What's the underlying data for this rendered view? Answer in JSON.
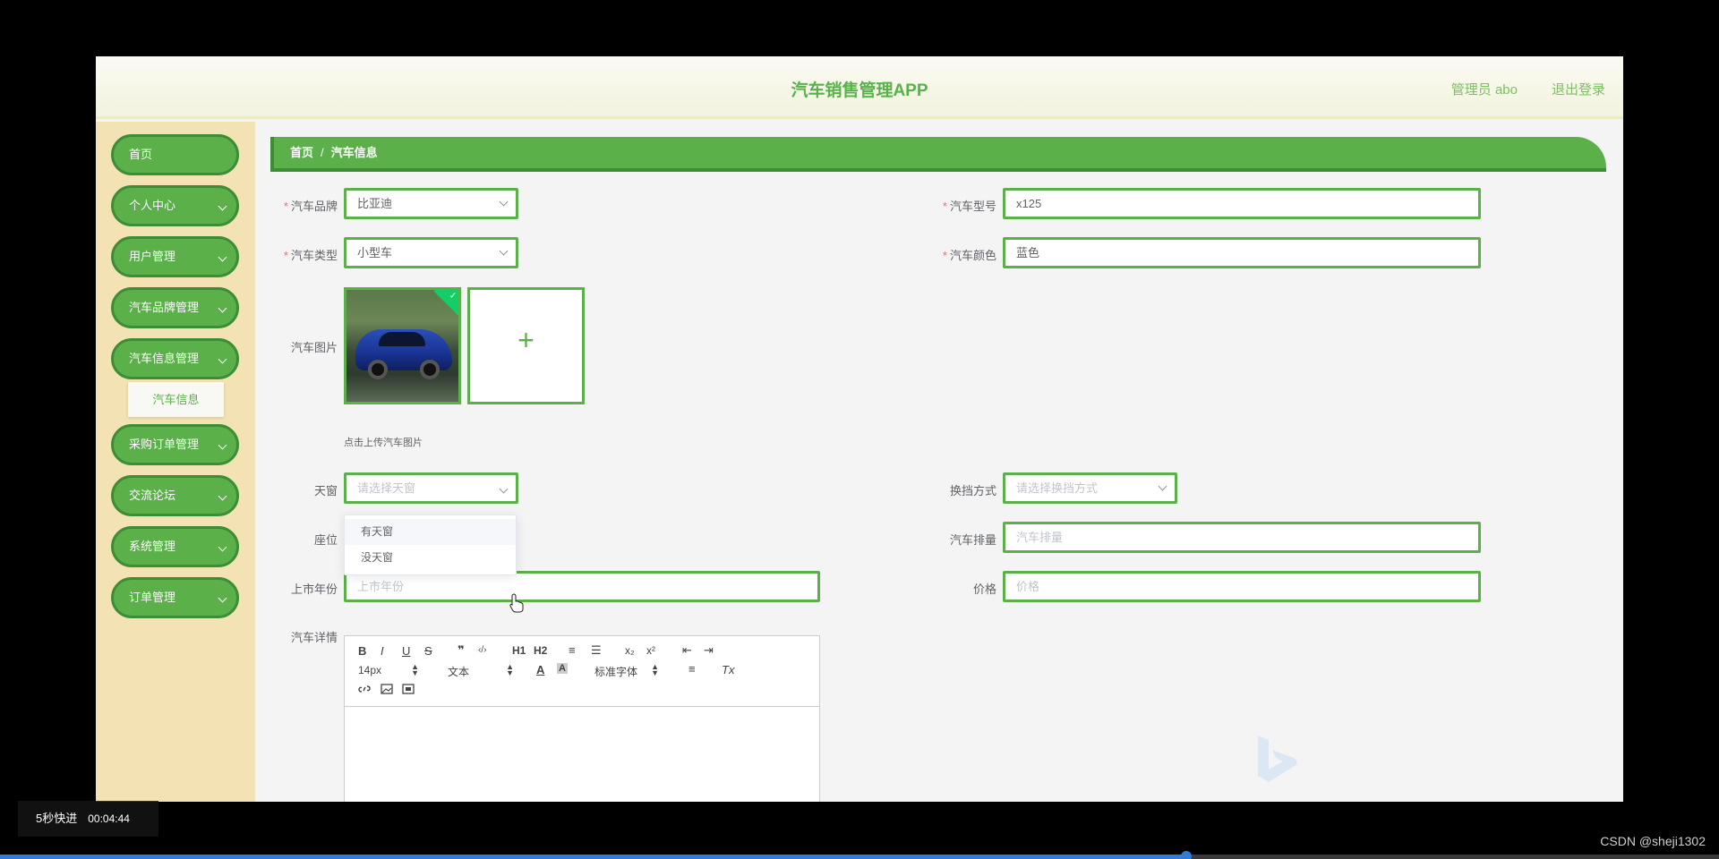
{
  "header": {
    "title": "汽车销售管理APP",
    "user": "管理员 abo",
    "logout": "退出登录"
  },
  "sidebar": {
    "items": [
      {
        "label": "首页"
      },
      {
        "label": "个人中心"
      },
      {
        "label": "用户管理"
      },
      {
        "label": "汽车品牌管理"
      },
      {
        "label": "汽车信息管理"
      },
      {
        "label": "采购订单管理"
      },
      {
        "label": "交流论坛"
      },
      {
        "label": "系统管理"
      },
      {
        "label": "订单管理"
      }
    ],
    "subitem": "汽车信息"
  },
  "breadcrumb": {
    "home": "首页",
    "separator": "/",
    "current": "汽车信息"
  },
  "form": {
    "brand": {
      "label": "汽车品牌",
      "value": "比亚迪"
    },
    "model": {
      "label": "汽车型号",
      "value": "x125"
    },
    "type": {
      "label": "汽车类型",
      "value": "小型车"
    },
    "color": {
      "label": "汽车颜色",
      "value": "蓝色"
    },
    "image": {
      "label": "汽车图片",
      "tip": "点击上传汽车图片",
      "plus": "+"
    },
    "sunroof": {
      "label": "天窗",
      "placeholder": "请选择天窗",
      "options": [
        "有天窗",
        "没天窗"
      ]
    },
    "gearbox": {
      "label": "换挡方式",
      "placeholder": "请选择换挡方式"
    },
    "seats": {
      "label": "座位"
    },
    "displacement": {
      "label": "汽车排量",
      "placeholder": "汽车排量"
    },
    "year": {
      "label": "上市年份",
      "placeholder": "上市年份"
    },
    "price": {
      "label": "价格",
      "placeholder": "价格"
    },
    "details": {
      "label": "汽车详情"
    },
    "required_mark": "*"
  },
  "editor": {
    "buttons": [
      "B",
      "I",
      "U",
      "S",
      "❞",
      "‹/›",
      "H1",
      "H2",
      "≡",
      "☰",
      "x₂",
      "x²",
      "⇤",
      "⇥"
    ],
    "font_size": "14px",
    "text_style": "文本",
    "font_family": "标准字体",
    "align": "≡",
    "clear": "Tx"
  },
  "video": {
    "speed": "5秒快进",
    "time": "00:04:44",
    "progress": 0.69
  },
  "credit": "CSDN @sheji1302"
}
